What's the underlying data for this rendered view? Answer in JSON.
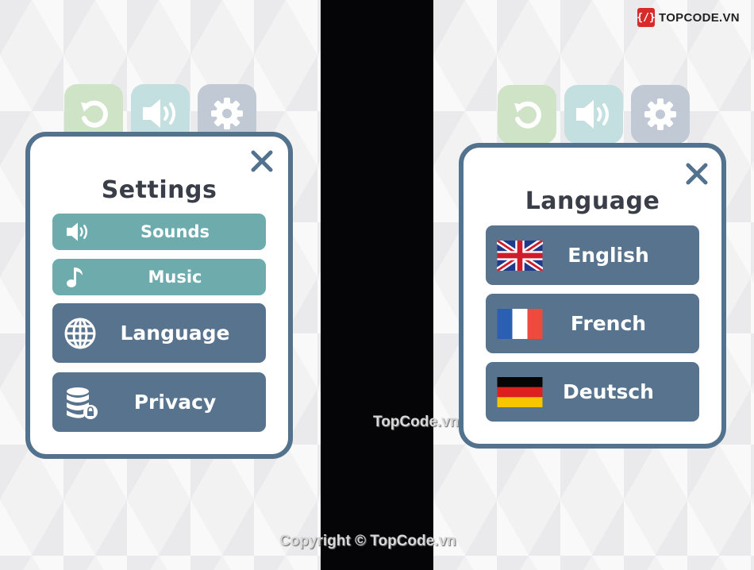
{
  "settings_screen": {
    "tabs": [
      {
        "icon": "restart-icon",
        "label": "Restart"
      },
      {
        "icon": "speaker-icon",
        "label": "Sound"
      },
      {
        "icon": "gear-icon",
        "label": "Settings"
      }
    ],
    "title": "Settings",
    "buttons": [
      {
        "icon": "speaker-icon",
        "label": "Sounds"
      },
      {
        "icon": "music-note-icon",
        "label": "Music"
      },
      {
        "icon": "globe-icon",
        "label": "Language"
      },
      {
        "icon": "database-lock-icon",
        "label": "Privacy"
      }
    ]
  },
  "language_screen": {
    "tabs": [
      {
        "icon": "restart-icon",
        "label": "Restart"
      },
      {
        "icon": "speaker-icon",
        "label": "Sound"
      },
      {
        "icon": "gear-icon",
        "label": "Settings"
      }
    ],
    "title": "Language",
    "buttons": [
      {
        "icon": "uk-flag-icon",
        "label": "English"
      },
      {
        "icon": "france-flag-icon",
        "label": "French"
      },
      {
        "icon": "germany-flag-icon",
        "label": "Deutsch"
      }
    ]
  },
  "colors": {
    "panel_border": "#52728d",
    "teal_button": "#6eabad",
    "navy_button": "#57738d",
    "title_text": "#3a3e48"
  },
  "watermarks": {
    "logo_text": "TOPCODE.VN",
    "center": "TopCode.vn",
    "copyright": "Copyright © TopCode.vn"
  }
}
